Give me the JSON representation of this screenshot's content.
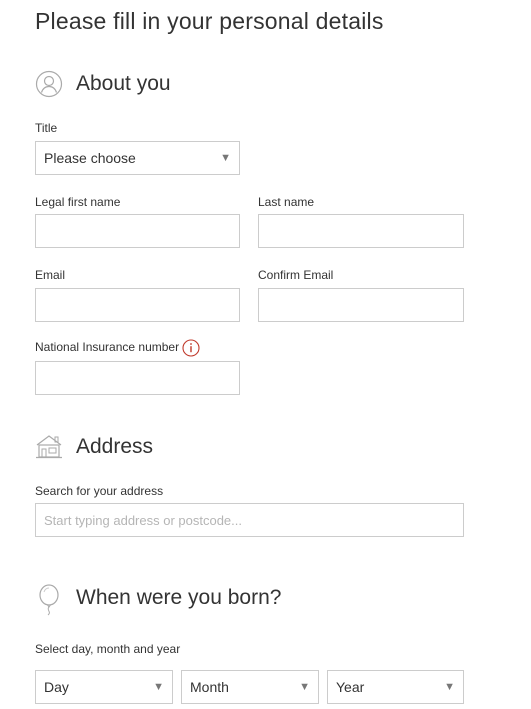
{
  "page": {
    "title": "Please fill in your personal details"
  },
  "about": {
    "heading": "About you",
    "icon": "user-icon",
    "title_label": "Title",
    "title_value": "Please choose",
    "first_name_label": "Legal first name",
    "first_name_value": "",
    "last_name_label": "Last name",
    "last_name_value": "",
    "email_label": "Email",
    "email_value": "",
    "confirm_email_label": "Confirm Email",
    "confirm_email_value": "",
    "ni_label": "National Insurance number",
    "ni_value": ""
  },
  "address": {
    "heading": "Address",
    "icon": "house-icon",
    "search_label": "Search for your address",
    "search_placeholder": "Start typing address or postcode..."
  },
  "birth": {
    "heading": "When were you born?",
    "icon": "balloon-icon",
    "select_label": "Select day, month and year",
    "day_value": "Day",
    "month_value": "Month",
    "year_value": "Year"
  },
  "colors": {
    "text": "#333333",
    "border": "#cccccc",
    "icon_line": "#aaaaaa",
    "info_icon": "#c0392b",
    "placeholder": "#b5b5b5"
  }
}
